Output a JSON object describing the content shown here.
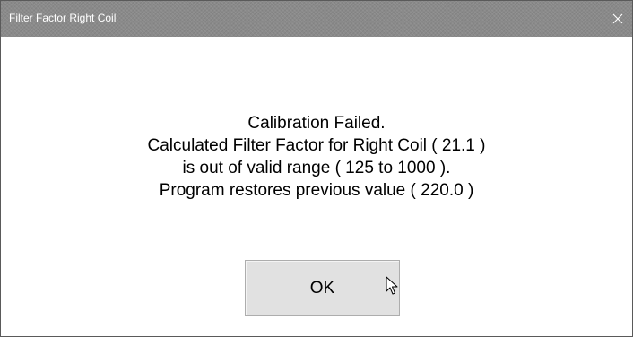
{
  "window": {
    "title": "Filter Factor Right Coil",
    "close_icon": "close-icon"
  },
  "message": {
    "line1": "Calibration Failed.",
    "line2": "Calculated Filter Factor for Right Coil ( 21.1 )",
    "line3": "is out of valid range ( 125 to 1000 ).",
    "line4": "Program restores previous value ( 220.0 )"
  },
  "buttons": {
    "ok_label": "OK"
  },
  "cursor": {
    "icon": "mouse-pointer-icon"
  },
  "colors": {
    "titlebar": "#8a8a8a",
    "window_background": "#ffffff",
    "button_face": "#e1e1e1",
    "button_border": "#adadad"
  }
}
